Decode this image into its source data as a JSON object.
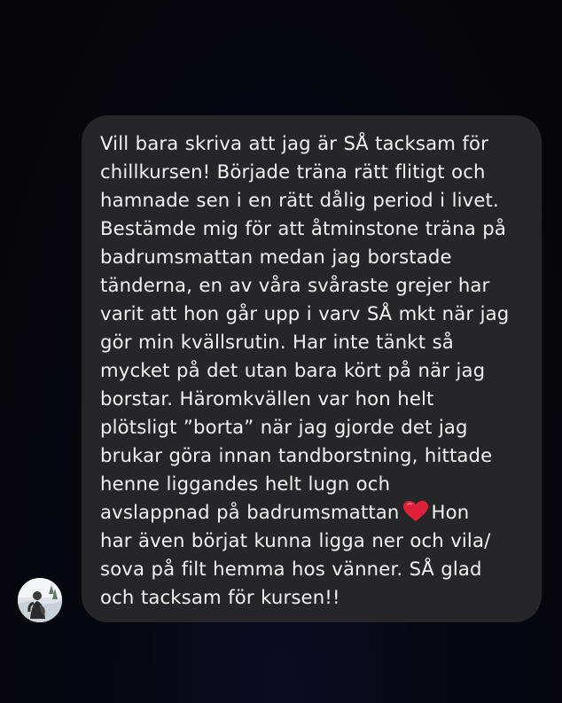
{
  "message": {
    "text_before_emoji": "Vill bara skriva att jag är SÅ tacksam för\nchillkursen! Började träna rätt flitigt och\nhamnade sen i en rätt dålig period i livet.\nBestämde mig för att åtminstone träna på\nbadrumsmattan medan jag borstade\ntänderna, en av våra svåraste grejer har\nvarit att hon går upp i varv SÅ mkt när jag\ngör min kvällsrutin. Har inte tänkt så\nmycket på det utan bara kört på när jag\nborstar. Häromkvällen var hon helt\nplötsligt ”borta” när jag gjorde det jag\nbrukar göra innan tandborstning, hittade\nhenne liggandes helt lugn och\navslappnad på badrumsmattan",
    "emoji": "red-heart-icon",
    "text_after_emoji": "Hon\nhar även börjat kunna ligga ner och vila/\nsova på filt hemma hos vänner. SÅ glad\noch tacksam för kursen!!"
  },
  "avatar": {
    "icon": "user-avatar-photo"
  },
  "colors": {
    "background": "#07070d",
    "bubble": "#262629",
    "text": "#f2f2f2",
    "heart": "#e0203a"
  }
}
